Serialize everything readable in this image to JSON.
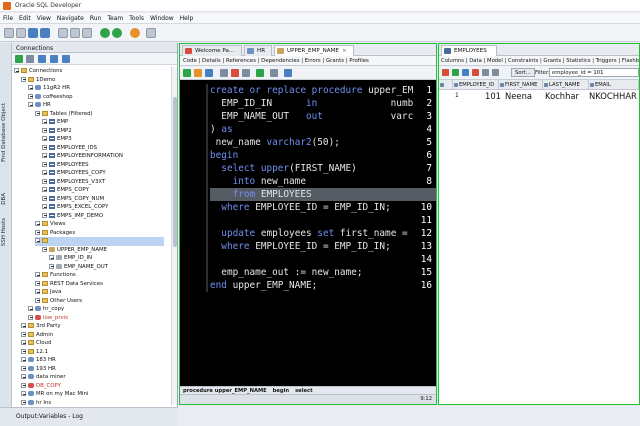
{
  "window": {
    "title": "Oracle SQL Developer"
  },
  "menu": [
    "File",
    "Edit",
    "View",
    "Navigate",
    "Run",
    "Team",
    "Tools",
    "Window",
    "Help"
  ],
  "left_strip": {
    "labels": [
      "Find Database Object",
      "DBA",
      "SSH Hosts"
    ]
  },
  "connections": {
    "header": "Connections",
    "tree": [
      {
        "label": "Connections",
        "icon": "folder",
        "depth": 0
      },
      {
        "label": "1Demo",
        "icon": "folder",
        "depth": 1
      },
      {
        "label": "11gR2 HR",
        "icon": "db",
        "depth": 2
      },
      {
        "label": "coffeeshop",
        "icon": "db",
        "depth": 2
      },
      {
        "label": "HR",
        "icon": "db",
        "depth": 2
      },
      {
        "label": "Tables (Filtered)",
        "icon": "folder",
        "depth": 3
      },
      {
        "label": "EMP",
        "icon": "table",
        "depth": 4
      },
      {
        "label": "EMP2",
        "icon": "table",
        "depth": 4
      },
      {
        "label": "EMP3",
        "icon": "table",
        "depth": 4
      },
      {
        "label": "EMPLOYEE_IDS",
        "icon": "table",
        "depth": 4
      },
      {
        "label": "EMPLOYEEINFORMATION",
        "icon": "table",
        "depth": 4
      },
      {
        "label": "EMPLOYEES",
        "icon": "table",
        "depth": 4
      },
      {
        "label": "EMPLOYEES_COPY",
        "icon": "table",
        "depth": 4
      },
      {
        "label": "EMPLOYEES_V3XT",
        "icon": "table",
        "depth": 4
      },
      {
        "label": "EMPS_COPY",
        "icon": "table",
        "depth": 4
      },
      {
        "label": "EMPS_COPY_NUM",
        "icon": "table",
        "depth": 4
      },
      {
        "label": "EMPS_EXCEL_COPY",
        "icon": "table",
        "depth": 4
      },
      {
        "label": "EMPS_IMP_DEMO",
        "icon": "table",
        "depth": 4
      },
      {
        "label": "Views",
        "icon": "folder",
        "depth": 3
      },
      {
        "label": "Packages",
        "icon": "folder",
        "depth": 3
      },
      {
        "label": "",
        "icon": "folder",
        "depth": 3
      },
      {
        "label": "UPPER_EMP_NAME",
        "icon": "proc",
        "depth": 4
      },
      {
        "label": "EMP_ID_IN",
        "icon": "obj",
        "depth": 5
      },
      {
        "label": "EMP_NAME_OUT",
        "icon": "obj",
        "depth": 5
      },
      {
        "label": "Functions",
        "icon": "folder",
        "depth": 3
      },
      {
        "label": "REST Data Services",
        "icon": "folder",
        "depth": 3
      },
      {
        "label": "Java",
        "icon": "folder",
        "depth": 3
      },
      {
        "label": "Other Users",
        "icon": "folder",
        "depth": 3
      },
      {
        "label": "hr_copy",
        "icon": "db",
        "depth": 2
      },
      {
        "label": "low_prvis",
        "icon": "dbred",
        "depth": 2
      },
      {
        "label": "3rd Party",
        "icon": "folder",
        "depth": 1
      },
      {
        "label": "Admin",
        "icon": "folder",
        "depth": 1
      },
      {
        "label": "Cloud",
        "icon": "folder",
        "depth": 1
      },
      {
        "label": "12.1",
        "icon": "folder",
        "depth": 1
      },
      {
        "label": "183 HR",
        "icon": "db",
        "depth": 1
      },
      {
        "label": "193 HR",
        "icon": "db",
        "depth": 1
      },
      {
        "label": "data miner",
        "icon": "db",
        "depth": 1
      },
      {
        "label": "DB_COPY",
        "icon": "dbred",
        "depth": 1
      },
      {
        "label": "MR on my Mac Mini",
        "icon": "db",
        "depth": 1
      },
      {
        "label": "hr Ins",
        "icon": "db",
        "depth": 1
      }
    ],
    "selected_index": 20
  },
  "bottom_panel": {
    "label": "Output:Variables - Log"
  },
  "editor": {
    "tabs": [
      "Welcome Pa...",
      "HR",
      "UPPER_EMP_NAME"
    ],
    "active_tab": 2,
    "subtabs": "Code | Details | References | Dependencies | Errors | Grants | Profiles",
    "lines": [
      "create or replace procedure upper_EM",
      "  EMP_ID_IN      in             numb",
      "  EMP_NAME_OUT   out            varc",
      ") as",
      " new_name varchar2(50);",
      "begin",
      "  select upper(FIRST_NAME)",
      "    into new_name",
      "    from EMPLOYEES",
      "  where EMPLOYEE_ID = EMP_ID_IN;",
      "",
      "  update employees set first_name =",
      "  where EMPLOYEE_ID = EMP_ID_IN;",
      "",
      "  emp_name_out := new_name;",
      "end upper_EMP_NAME;"
    ],
    "highlighted_line": 9,
    "status_path": [
      "procedure upper_EMP_NAME",
      "begin",
      "select"
    ],
    "cursor_pos": "9:12"
  },
  "results": {
    "tab": "EMPLOYEES",
    "subtabs": "Columns | Data | Model | Constraints | Grants | Statistics | Triggers | Flashback | Depen",
    "sort_label": "Sort...",
    "filter_label": "Filter:",
    "filter_value": "employee_id = 101",
    "columns": [
      "EMPLOYEE_ID",
      "FIRST_NAME",
      "LAST_NAME",
      "EMAIL"
    ],
    "row": {
      "index": "1",
      "employee_id": "101",
      "first_name": "Neena",
      "last_name": "Kochhar",
      "email": "NKOCHHAR"
    }
  },
  "colors": {
    "accent_border": "#1fbf3a",
    "code_bg": "#000000",
    "keyword": "#6f8ff0"
  }
}
